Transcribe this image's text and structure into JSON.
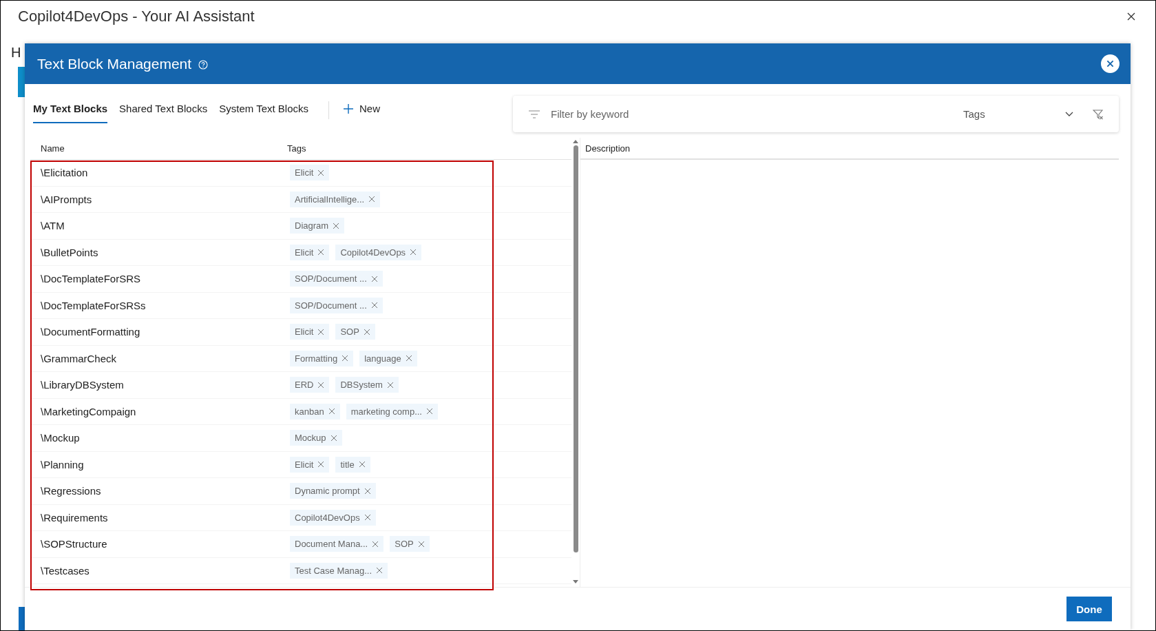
{
  "window": {
    "title": "Copilot4DevOps - Your AI Assistant",
    "background_heading": "H"
  },
  "dialog": {
    "title": "Text Block Management",
    "tabs": [
      {
        "label": "My Text Blocks",
        "selected": true
      },
      {
        "label": "Shared Text Blocks",
        "selected": false
      },
      {
        "label": "System Text Blocks",
        "selected": false
      }
    ],
    "new_button": "New",
    "filter": {
      "placeholder": "Filter by keyword",
      "tags_placeholder": "Tags"
    },
    "columns": [
      "Name",
      "Tags",
      "Description"
    ],
    "rows": [
      {
        "name": "\\Elicitation",
        "tags": [
          "Elicit"
        ]
      },
      {
        "name": "\\AIPrompts",
        "tags": [
          "ArtificialIntellige..."
        ]
      },
      {
        "name": "\\ATM",
        "tags": [
          "Diagram"
        ]
      },
      {
        "name": "\\BulletPoints",
        "tags": [
          "Elicit",
          "Copilot4DevOps"
        ]
      },
      {
        "name": "\\DocTemplateForSRS",
        "tags": [
          "SOP/Document ..."
        ]
      },
      {
        "name": "\\DocTemplateForSRSs",
        "tags": [
          "SOP/Document ..."
        ]
      },
      {
        "name": "\\DocumentFormatting",
        "tags": [
          "Elicit",
          "SOP"
        ]
      },
      {
        "name": "\\GrammarCheck",
        "tags": [
          "Formatting",
          "language"
        ]
      },
      {
        "name": "\\LibraryDBSystem",
        "tags": [
          "ERD",
          "DBSystem"
        ]
      },
      {
        "name": "\\MarketingCompaign",
        "tags": [
          "kanban",
          "marketing comp..."
        ]
      },
      {
        "name": "\\Mockup",
        "tags": [
          "Mockup"
        ]
      },
      {
        "name": "\\Planning",
        "tags": [
          "Elicit",
          "title"
        ]
      },
      {
        "name": "\\Regressions",
        "tags": [
          "Dynamic prompt"
        ]
      },
      {
        "name": "\\Requirements",
        "tags": [
          "Copilot4DevOps"
        ]
      },
      {
        "name": "\\SOPStructure",
        "tags": [
          "Document Mana...",
          "SOP"
        ]
      },
      {
        "name": "\\Testcases",
        "tags": [
          "Test Case Manag..."
        ]
      }
    ],
    "done_button": "Done"
  }
}
